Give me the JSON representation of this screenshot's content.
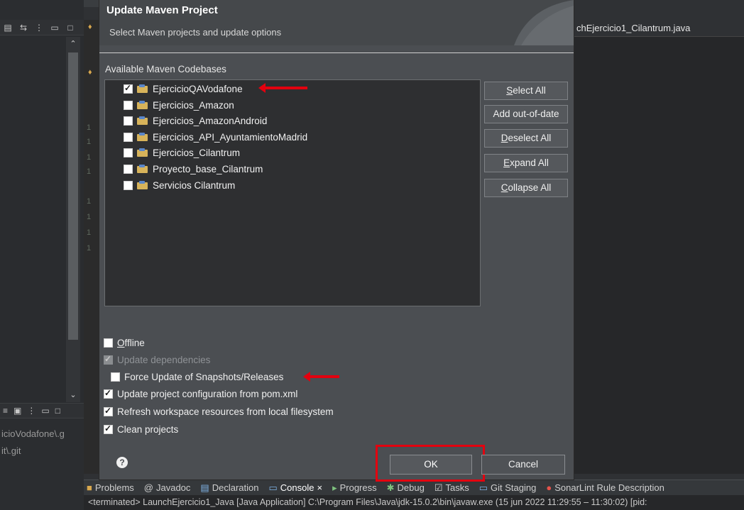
{
  "ide": {
    "editor_tab": "chEjercicio1_Cilantrum.java",
    "left_paths": [
      "icioVodafone\\.g",
      "it\\.git"
    ],
    "bottom_tabs": [
      {
        "label": "Problems",
        "active": false
      },
      {
        "label": "Javadoc",
        "active": false
      },
      {
        "label": "Declaration",
        "active": false
      },
      {
        "label": "Console",
        "active": true
      },
      {
        "label": "Progress",
        "active": false
      },
      {
        "label": "Debug",
        "active": false
      },
      {
        "label": "Tasks",
        "active": false
      },
      {
        "label": "Git Staging",
        "active": false
      },
      {
        "label": "SonarLint Rule Description",
        "active": false
      }
    ],
    "console_line": "<terminated> LaunchEjercicio1_Java [Java Application] C:\\Program Files\\Java\\jdk-15.0.2\\bin\\javaw.exe  (15 jun 2022 11:29:55 – 11:30:02) [pid:",
    "gutter_numbers": [
      "1",
      "1",
      "1",
      "1",
      "1",
      "1",
      "1",
      "1"
    ]
  },
  "dialog": {
    "title": "Update Maven Project",
    "subtitle": "Select Maven projects and update options",
    "codebases_label": "Available Maven Codebases",
    "projects": [
      {
        "name": "EjercicioQAVodafone",
        "checked": true
      },
      {
        "name": "Ejercicios_Amazon",
        "checked": false
      },
      {
        "name": "Ejercicios_AmazonAndroid",
        "checked": false
      },
      {
        "name": "Ejercicios_API_AyuntamientoMadrid",
        "checked": false
      },
      {
        "name": "Ejercicios_Cilantrum",
        "checked": false
      },
      {
        "name": "Proyecto_base_Cilantrum",
        "checked": false
      },
      {
        "name": "Servicios Cilantrum",
        "checked": false
      }
    ],
    "side_buttons": {
      "select_all": "Select All",
      "add_out_of_date": "Add out-of-date",
      "deselect_all": "Deselect All",
      "expand_all": "Expand All",
      "collapse_all": "Collapse All"
    },
    "options": {
      "offline": {
        "label": "Offline",
        "checked": false
      },
      "update_dependencies": {
        "label": "Update dependencies",
        "checked": true,
        "enabled": false
      },
      "force_update": {
        "label": "Force Update of Snapshots/Releases",
        "checked": false
      },
      "update_config": {
        "label": "Update project configuration from pom.xml",
        "checked": true
      },
      "refresh_workspace": {
        "label": "Refresh workspace resources from local filesystem",
        "checked": true
      },
      "clean_projects": {
        "label": "Clean projects",
        "checked": true
      }
    },
    "ok_label": "OK",
    "cancel_label": "Cancel",
    "help_glyph": "?"
  },
  "colors": {
    "annotation_red": "#e3000f",
    "dialog_bg": "#4b4e52",
    "tree_bg": "#2e2f31"
  }
}
